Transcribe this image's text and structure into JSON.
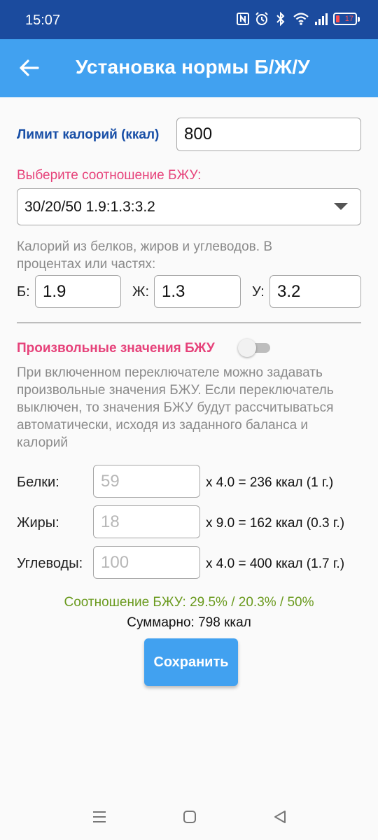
{
  "status_bar": {
    "time": "15:07",
    "battery_level": "17",
    "icons": [
      "nfc-icon",
      "alarm-icon",
      "bluetooth-icon",
      "wifi-icon",
      "signal-icon",
      "battery-icon"
    ]
  },
  "app_bar": {
    "title": "Установка нормы Б/Ж/У",
    "back_icon": "arrow-left-icon"
  },
  "calorie_limit": {
    "label": "Лимит калорий (ккал)",
    "value": "800"
  },
  "ratio_select": {
    "label": "Выберите соотношение БЖУ:",
    "selected": "30/20/50 1.9:1.3:3.2"
  },
  "parts": {
    "hint": "Калорий из белков, жиров и углеводов. В процентах или частях:",
    "protein_label": "Б:",
    "protein_value": "1.9",
    "fat_label": "Ж:",
    "fat_value": "1.3",
    "carbs_label": "У:",
    "carbs_value": "3.2"
  },
  "custom": {
    "label": "Произвольные значения БЖУ",
    "enabled": false,
    "description": "При включенном переключателе можно задавать произвольные значения БЖУ. Если переключатель выключен, то значения БЖУ будут рассчитываться автоматически, исходя из заданного баланса и калорий"
  },
  "nutrients": [
    {
      "label": "Белки:",
      "value": "59",
      "calc": "x 4.0 = 236 ккал (1 г.)"
    },
    {
      "label": "Жиры:",
      "value": "18",
      "calc": "x 9.0 = 162 ккал (0.3 г.)"
    },
    {
      "label": "Углеводы:",
      "value": "100",
      "calc": "x 4.0 = 400 ккал (1.7 г.)"
    }
  ],
  "summary": {
    "ratio": "Соотношение БЖУ: 29.5% / 20.3% / 50%",
    "total": "Суммарно: 798 ккал"
  },
  "save_label": "Сохранить",
  "nav": {
    "icons": [
      "menu-icon",
      "home-icon",
      "back-icon"
    ]
  },
  "colors": {
    "status_bar": "#1b4b9e",
    "app_bar": "#41a1f0",
    "label_blue": "#174ea6",
    "label_pink": "#e6427a",
    "ratio_green": "#6a9a1e"
  }
}
